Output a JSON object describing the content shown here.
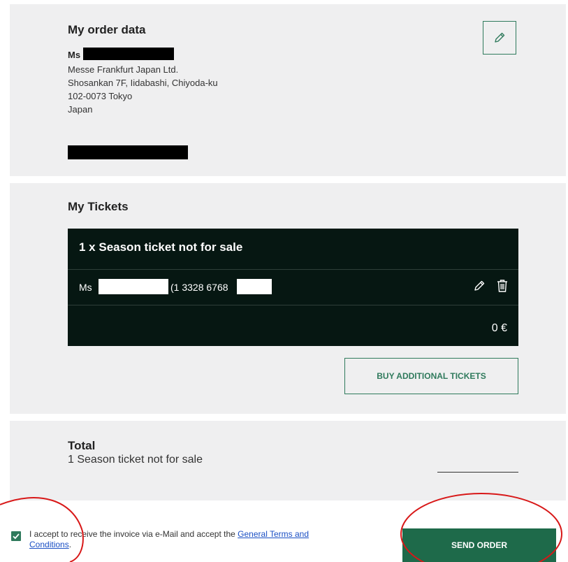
{
  "order": {
    "title": "My order data",
    "salutation": "Ms",
    "address": [
      "Messe Frankfurt Japan Ltd.",
      "Shosankan 7F, Iidabashi, Chiyoda-ku",
      "102-0073 Tokyo",
      "Japan"
    ]
  },
  "tickets": {
    "title": "My Tickets",
    "item_title": "1 x Season ticket not for sale",
    "holder_salutation": "Ms",
    "holder_number": "(1 3328 6768",
    "price": "0 €",
    "buy_label": "BUY ADDITIONAL TICKETS"
  },
  "total": {
    "title": "Total",
    "line": "1 Season ticket not for sale"
  },
  "footer": {
    "accept_text": "I accept to receive the invoice via e-Mail and accept the ",
    "terms_link": "General Terms and Conditions",
    "accept_suffix": ".",
    "accepted": true,
    "send_label": "SEND ORDER"
  },
  "colors": {
    "accent": "#2f7a5c",
    "button_dark": "#1e6a4a",
    "ticket_bg": "#061712",
    "panel_bg": "#efeff0",
    "annotation": "#d81818"
  },
  "icons": {
    "edit": "pencil-icon",
    "delete": "trash-icon",
    "check": "checkmark-icon"
  }
}
